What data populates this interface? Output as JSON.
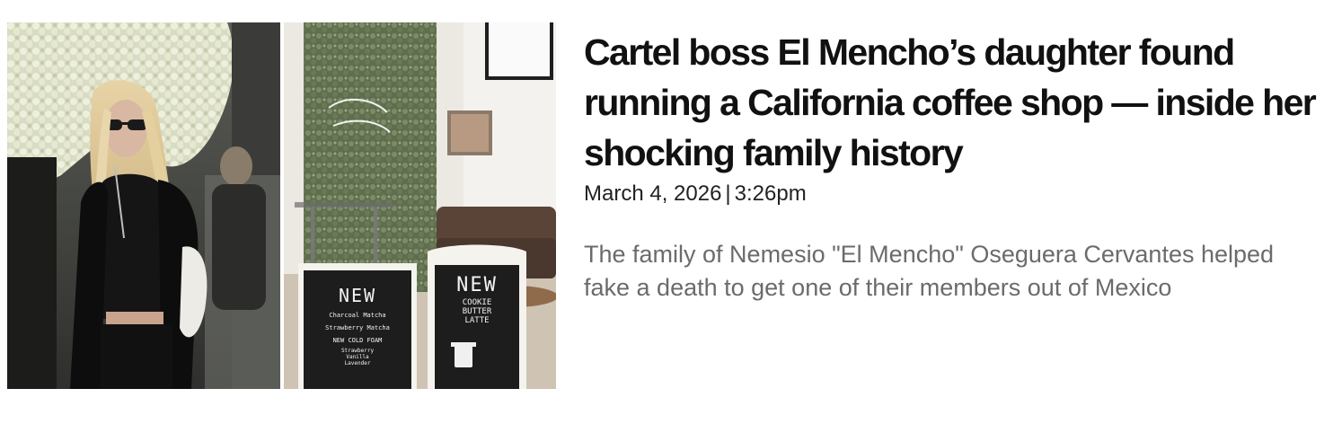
{
  "article": {
    "headline": "Cartel boss El Mencho’s daughter found running a California coffee shop — inside her shocking family history",
    "date": "March 4, 2026",
    "separator": "|",
    "time": "3:26pm",
    "summary": "The family of Nemesio \"El Mencho\" Oseguera Cervantes helped fake a death to get one of their members out of Mexico"
  },
  "photos": {
    "left_description_icon": "woman-sunglasses-photo",
    "right_description_icon": "coffee-shop-interior-photo",
    "sign_left": {
      "heading": "NEW",
      "lines": [
        "Charcoal Matcha",
        "Strawberry Matcha",
        "NEW COLD FOAM",
        "Strawberry",
        "Vanilla",
        "Lavender"
      ]
    },
    "sign_right": {
      "heading": "NEW",
      "lines": [
        "COOKIE",
        "BUTTER",
        "LATTE"
      ]
    }
  }
}
